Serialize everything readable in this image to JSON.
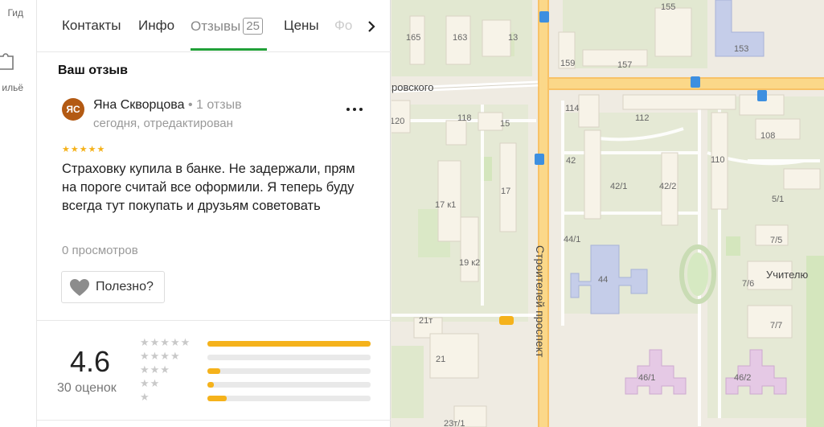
{
  "rail": {
    "item1_label": "Гид",
    "item2_label": "ильё"
  },
  "tabs": [
    {
      "label": "Контакты"
    },
    {
      "label": "Инфо"
    },
    {
      "label": "Отзывы",
      "count": "25"
    },
    {
      "label": "Цены"
    },
    {
      "label": "Фо"
    }
  ],
  "review": {
    "heading": "Ваш отзыв",
    "avatar_initials": "ЯС",
    "author": "Яна Скворцова",
    "author_meta": "• 1 отзыв",
    "date": "сегодня, отредактирован",
    "stars": "★★★★★",
    "rating": 5,
    "text": "Страховку купила в банке. Не задержали, прям на пороге считай все оформили. Я теперь буду всегда тут покупать и друзьям советовать",
    "views": "0 просмотров",
    "useful_label": "Полезно?"
  },
  "summary": {
    "rating": "4.6",
    "count": "30 оценок",
    "distribution": [
      {
        "stars": "★★★★★",
        "fraction": 1.0
      },
      {
        "stars": "★★★★",
        "fraction": 0.0
      },
      {
        "stars": "★★★",
        "fraction": 0.08
      },
      {
        "stars": "★★",
        "fraction": 0.04
      },
      {
        "stars": "★",
        "fraction": 0.12
      }
    ]
  },
  "map": {
    "street_labels": [
      "ровского",
      "Строителей проспект",
      "Учителю"
    ],
    "building_labels": [
      "165",
      "163",
      "13",
      "159",
      "157",
      "155",
      "153",
      "114",
      "112",
      "120",
      "118",
      "15",
      "108",
      "42",
      "110",
      "17 к1",
      "17",
      "42/1",
      "42/2",
      "5/1",
      "44/1",
      "7/5",
      "19 к2",
      "44",
      "7/6",
      "21т",
      "7/7",
      "21",
      "46/1",
      "46/2",
      "23т/1"
    ],
    "colors": {
      "road": "#f9c35d",
      "park": "#c9e3b0",
      "building": "#f7f3e8",
      "school": "#c5cde9",
      "kindergarten": "#e5c9e5"
    }
  }
}
